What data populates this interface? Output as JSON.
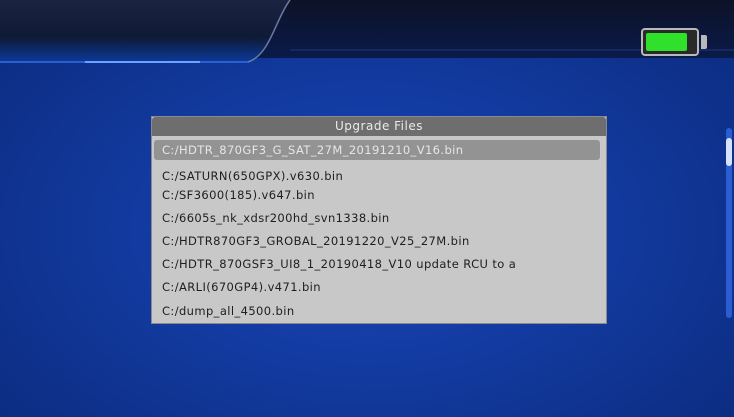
{
  "dialog": {
    "title": "Upgrade Files",
    "files": [
      "C:/HDTR_870GF3_G_SAT_27M_20191210_V16.bin",
      "C:/SATURN(650GPX).v630.bin",
      "C:/SF3600(185).v647.bin",
      "C:/6605s_nk_xdsr200hd_svn1338.bin",
      "C:/HDTR870GF3_GROBAL_20191220_V25_27M.bin",
      "C:/HDTR_870GSF3_UI8_1_20190418_V10 update RCU to a",
      "C:/ARLI(670GP4).v471.bin",
      "C:/dump_all_4500.bin"
    ],
    "selected_index": 0
  },
  "battery": {
    "level": 0.85,
    "color": "#2fe12b"
  },
  "colors": {
    "background": "#123a9f",
    "dialog": "#c8c8c8",
    "title_bar": "#6e6e6e",
    "selected_row": "#939393"
  }
}
